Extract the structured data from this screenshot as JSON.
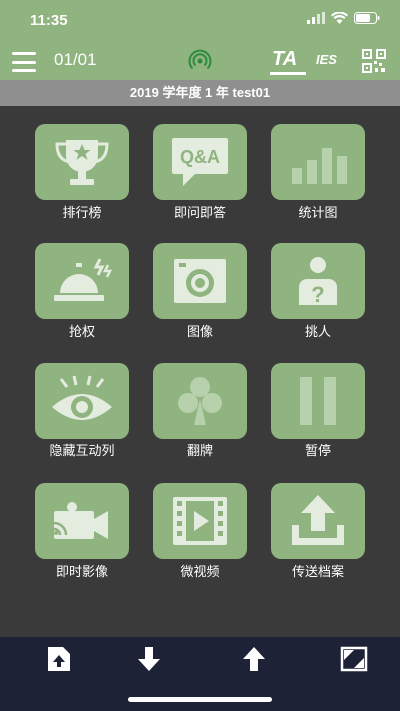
{
  "status": {
    "time": "11:35"
  },
  "nav": {
    "page_count": "01/01",
    "ta_label": "TA",
    "ies_label": "IES"
  },
  "title": "2019 学年度 1 年 test01",
  "tiles": [
    {
      "label": "排行榜",
      "icon": "trophy-icon"
    },
    {
      "label": "即问即答",
      "icon": "qa-icon"
    },
    {
      "label": "统计图",
      "icon": "bar-chart-icon"
    },
    {
      "label": "抢权",
      "icon": "bell-icon"
    },
    {
      "label": "图像",
      "icon": "camera-icon"
    },
    {
      "label": "挑人",
      "icon": "person-question-icon"
    },
    {
      "label": "隐藏互动列",
      "icon": "eye-icon"
    },
    {
      "label": "翻牌",
      "icon": "club-card-icon"
    },
    {
      "label": "暂停",
      "icon": "pause-icon"
    },
    {
      "label": "即时影像",
      "icon": "video-camera-icon"
    },
    {
      "label": "微视频",
      "icon": "film-icon"
    },
    {
      "label": "传送档案",
      "icon": "upload-icon"
    }
  ],
  "bottom_bar": [
    "file-upload-icon",
    "arrow-down-icon",
    "arrow-up-icon",
    "window-toggle-icon"
  ],
  "colors": {
    "accent": "#8fb47f",
    "background": "#3a3a3a",
    "title_bar": "#8f8f8f",
    "bottom_bar": "#1e2236"
  }
}
